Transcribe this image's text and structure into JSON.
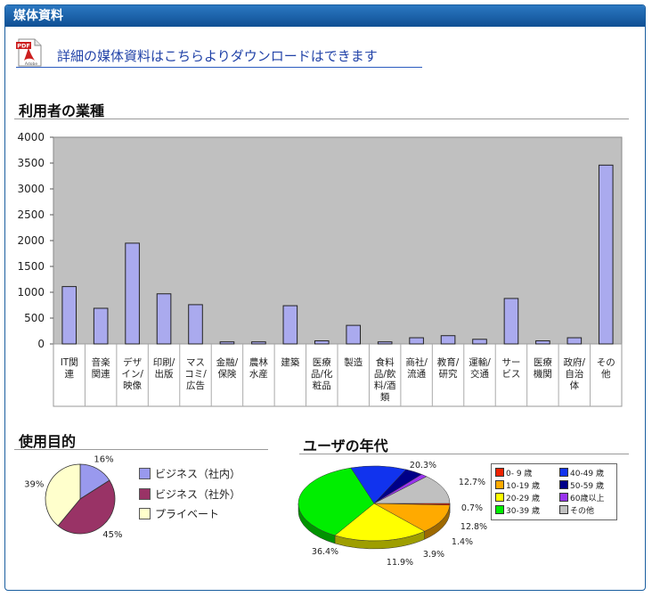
{
  "header": {
    "title": "媒体資料"
  },
  "download": {
    "icon": "pdf-adobe-icon",
    "pdf_tag": "PDF",
    "adobe_tag": "Adobe",
    "link": "詳細の媒体資料はこちらよりダウンロードはできます"
  },
  "sections": {
    "industry": "利用者の業種",
    "purpose": "使用目的",
    "age": "ユーザの年代"
  },
  "chart_data": [
    {
      "type": "bar",
      "title": "利用者の業種",
      "ylim": [
        0,
        4000
      ],
      "yticks": [
        "4000",
        "3500",
        "3000",
        "2500",
        "2000",
        "1500",
        "1000",
        "500",
        "0"
      ],
      "grid": false,
      "bar_color": "#aaaaee",
      "plot_bg": "#c0c0c0",
      "categories": [
        [
          "IT関",
          "連"
        ],
        [
          "音楽",
          "関連"
        ],
        [
          "デザ",
          "イン/",
          "映像"
        ],
        [
          "印刷/",
          "出版"
        ],
        [
          "マス",
          "コミ/",
          "広告"
        ],
        [
          "金融/",
          "保険"
        ],
        [
          "農林",
          "水産"
        ],
        [
          "建築"
        ],
        [
          "医療",
          "品/化",
          "粧品"
        ],
        [
          "製造"
        ],
        [
          "食料",
          "品/飲",
          "料/酒",
          "類"
        ],
        [
          "商社/",
          "流通"
        ],
        [
          "教育/",
          "研究"
        ],
        [
          "運輸/",
          "交通"
        ],
        [
          "サー",
          "ビス"
        ],
        [
          "医療",
          "機関"
        ],
        [
          "政府/",
          "自治",
          "体"
        ],
        [
          "その",
          "他"
        ]
      ],
      "values": [
        1110,
        690,
        1950,
        970,
        760,
        40,
        40,
        740,
        60,
        360,
        40,
        120,
        160,
        90,
        880,
        60,
        120,
        3460
      ]
    },
    {
      "type": "pie",
      "title": "使用目的",
      "slices": [
        {
          "name": "ビジネス（社内）",
          "value": 16,
          "label": "16%",
          "color": "#9999ee"
        },
        {
          "name": "ビジネス（社外）",
          "value": 45,
          "label": "45%",
          "color": "#993366"
        },
        {
          "name": "プライベート",
          "value": 39,
          "label": "39%",
          "color": "#ffffcc"
        }
      ]
    },
    {
      "type": "pie",
      "title": "ユーザの年代",
      "slices": [
        {
          "name": "0- 9 歳",
          "value": 0.7,
          "label": "0.7%",
          "color": "#ee2200"
        },
        {
          "name": "10-19 歳",
          "value": 12.7,
          "label": "12.7%",
          "color": "#ffaa00"
        },
        {
          "name": "20-29 歳",
          "value": 20.3,
          "label": "20.3%",
          "color": "#ffff00"
        },
        {
          "name": "30-39 歳",
          "value": 36.4,
          "label": "36.4%",
          "color": "#00ee00"
        },
        {
          "name": "40-49 歳",
          "value": 11.9,
          "label": "11.9%",
          "color": "#1133ee"
        },
        {
          "name": "50-59 歳",
          "value": 3.9,
          "label": "3.9%",
          "color": "#000088"
        },
        {
          "name": "60歳以上",
          "value": 1.4,
          "label": "1.4%",
          "color": "#9933ee"
        },
        {
          "name": "その他",
          "value": 12.8,
          "label": "12.8%",
          "color": "#c0c0c0"
        }
      ]
    }
  ]
}
